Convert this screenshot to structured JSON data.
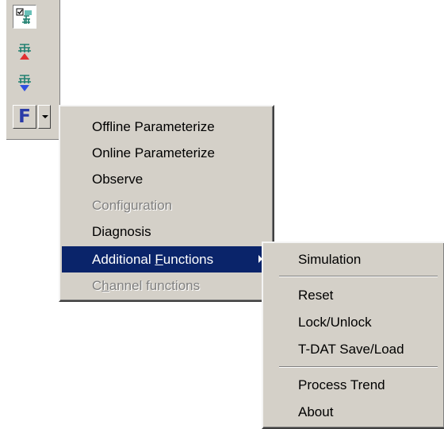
{
  "toolbar": {
    "buttons": [
      {
        "icon": "tree-checked-icon",
        "pressed": true
      },
      {
        "icon": "tree-upload-red-icon"
      },
      {
        "icon": "tree-download-blue-icon"
      },
      {
        "icon": "function-f-icon",
        "glyph": "F"
      }
    ],
    "dropdown_icon": "chevron-down-icon"
  },
  "main_menu": {
    "items": [
      {
        "label": "Offline Parameterize",
        "enabled": true
      },
      {
        "label": "Online Parameterize",
        "enabled": true
      },
      {
        "label": "Observe",
        "enabled": true
      },
      {
        "label": "Configuration",
        "enabled": false
      },
      {
        "label": "Diagnosis",
        "enabled": true
      },
      {
        "label_pre": "Additional ",
        "label_key": "F",
        "label_post": "unctions",
        "enabled": true,
        "highlighted": true,
        "has_submenu": true
      },
      {
        "label_pre": "C",
        "label_key": "h",
        "label_post": "annel functions",
        "enabled": false
      }
    ]
  },
  "sub_menu": {
    "items": [
      {
        "label": "Simulation"
      },
      {
        "label": "Reset"
      },
      {
        "label": "Lock/Unlock"
      },
      {
        "label": "T-DAT Save/Load"
      },
      {
        "label": "Process Trend"
      },
      {
        "label": "About"
      }
    ]
  },
  "colors": {
    "menu_bg": "#d4d0c8",
    "highlight": "#0a246a",
    "disabled_text": "#808080",
    "f_icon": "#2a3aa8"
  }
}
